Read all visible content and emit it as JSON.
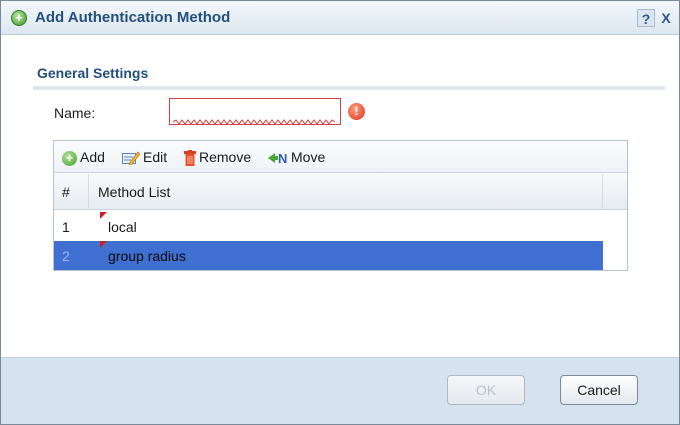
{
  "dialog": {
    "title": "Add Authentication Method",
    "help_label": "?",
    "close_label": "X"
  },
  "general": {
    "section_title": "General Settings",
    "name_label": "Name:",
    "name_value": "",
    "error_glyph": "!"
  },
  "toolbar": {
    "add_label": "Add",
    "edit_label": "Edit",
    "remove_label": "Remove",
    "move_label": "Move"
  },
  "table": {
    "columns": [
      "#",
      "Method List"
    ],
    "rows": [
      {
        "num": "1",
        "method": "local",
        "selected": false
      },
      {
        "num": "2",
        "method": "group radius",
        "selected": true
      }
    ]
  },
  "footer": {
    "ok_label": "OK",
    "cancel_label": "Cancel"
  },
  "colors": {
    "title_text": "#23507c",
    "selection": "#3e6fd1",
    "footer_bg": "#d6e2ee",
    "error": "#d9381e"
  },
  "icons": [
    "add-icon",
    "help-icon",
    "close-icon",
    "error-icon",
    "edit-icon",
    "remove-icon",
    "move-icon"
  ]
}
